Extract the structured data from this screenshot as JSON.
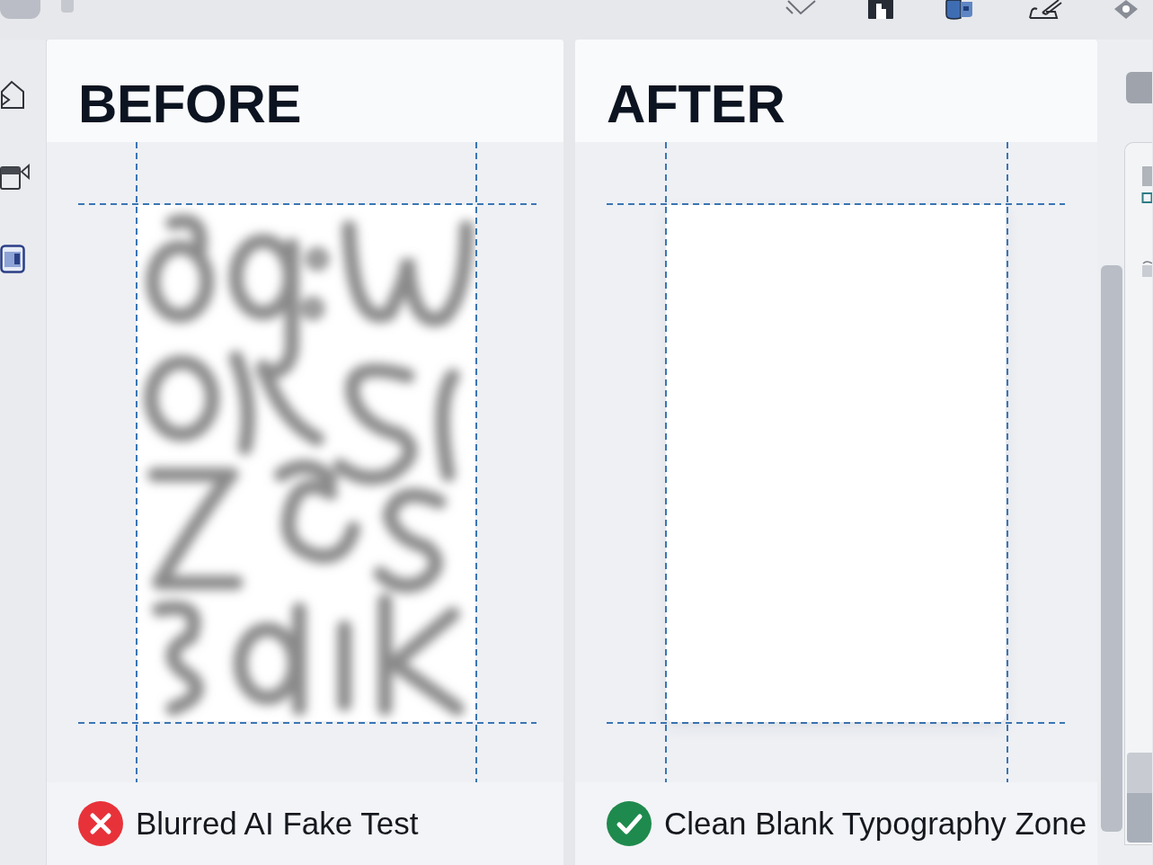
{
  "panels": [
    {
      "kind": "blurred",
      "heading": "BEFORE",
      "passed": false,
      "caption": "Blurred AI Fake Test"
    },
    {
      "kind": "blank",
      "heading": "AFTER",
      "passed": true,
      "caption": "Clean Blank Typography Zone"
    }
  ]
}
